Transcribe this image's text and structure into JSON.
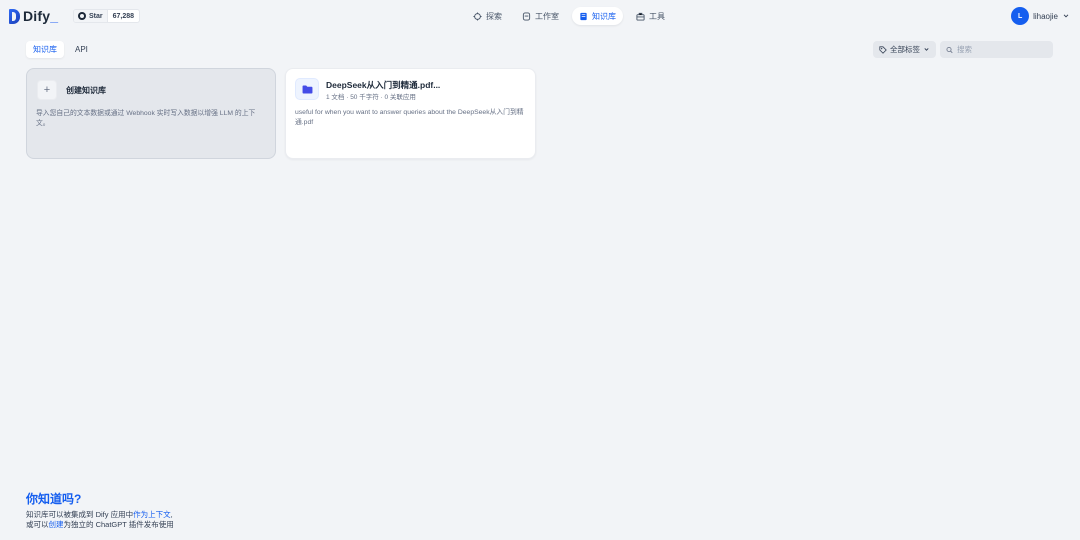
{
  "header": {
    "logo_text": "Dify",
    "logo_dot": "_",
    "github": {
      "star_label": "Star",
      "star_count": "67,288"
    },
    "nav": [
      {
        "label": "探索",
        "icon": "compass-icon",
        "active": false
      },
      {
        "label": "工作室",
        "icon": "studio-icon",
        "active": false
      },
      {
        "label": "知识库",
        "icon": "book-icon",
        "active": true
      },
      {
        "label": "工具",
        "icon": "toolbox-icon",
        "active": false
      }
    ],
    "user": {
      "initial": "L",
      "name": "lihaojie"
    }
  },
  "toolbar": {
    "tabs": [
      {
        "label": "知识库",
        "active": true
      },
      {
        "label": "API",
        "active": false
      }
    ],
    "tag_filter_label": "全部标签",
    "search_placeholder": "搜索"
  },
  "create_card": {
    "icon": "plus-icon",
    "plus": "+",
    "title": "创建知识库",
    "description": "导入您自己的文本数据或通过 Webhook 实时写入数据以增强 LLM 的上下文。"
  },
  "datasets": [
    {
      "icon": "folder-icon",
      "title": "DeepSeek从入门到精通.pdf...",
      "meta": "1 文档 · 50 千字符 · 0 关联应用",
      "description": "useful for when you want to answer queries about the DeepSeek从入门到精通.pdf"
    }
  ],
  "tip": {
    "title": "你知道吗?",
    "line1_prefix": "知识库可以被集成到 Dify 应用中",
    "line1_link": "作为上下文",
    "line1_suffix": ",",
    "line2_prefix": "或可以",
    "line2_link": "创建",
    "line2_suffix": "为独立的 ChatGPT 插件发布使用"
  },
  "colors": {
    "accent": "#155eef",
    "background": "#f2f4f7",
    "card": "#ffffff",
    "create_card": "#e4e7ec"
  }
}
